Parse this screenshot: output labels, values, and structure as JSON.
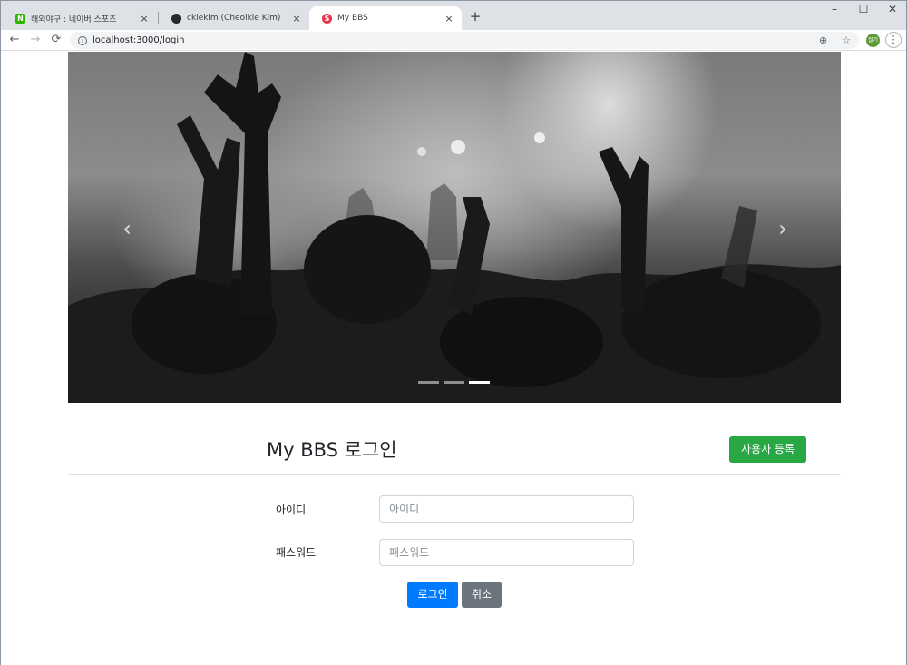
{
  "browser": {
    "tabs": [
      {
        "title": "해외야구 : 네이버 스포츠",
        "favicon": "naver-icon",
        "favicon_color": "#2db400",
        "favicon_glyph": "N"
      },
      {
        "title": "ckiekim (Cheolkie Kim)",
        "favicon": "github-icon",
        "favicon_color": "#24292e",
        "favicon_glyph": ""
      },
      {
        "title": "My BBS",
        "favicon": "bbs-s-icon",
        "favicon_color": "#e8344e",
        "favicon_glyph": "S"
      }
    ],
    "tab_close_glyph": "×",
    "new_tab_glyph": "+",
    "window_controls": {
      "minimize": "–",
      "maximize": "☐",
      "close": "✕"
    },
    "nav": {
      "back": "←",
      "forward": "→",
      "reload": "⟳"
    },
    "url": "localhost:3000/login",
    "omnibox_icons": {
      "zoom": "⊕",
      "star": "☆"
    },
    "profile_label": "절기",
    "menu_glyph": "⋮"
  },
  "carousel": {
    "prev_glyph": "‹",
    "next_glyph": "›",
    "slide_count": 3,
    "active_index": 2
  },
  "login": {
    "title": "My BBS 로그인",
    "signup_button": "사용자 등록",
    "id_label": "아이디",
    "id_placeholder": "아이디",
    "password_label": "패스워드",
    "password_placeholder": "패스워드",
    "login_button": "로그인",
    "cancel_button": "취소"
  },
  "colors": {
    "primary": "#007bff",
    "success": "#28a745",
    "secondary": "#6c757d"
  }
}
